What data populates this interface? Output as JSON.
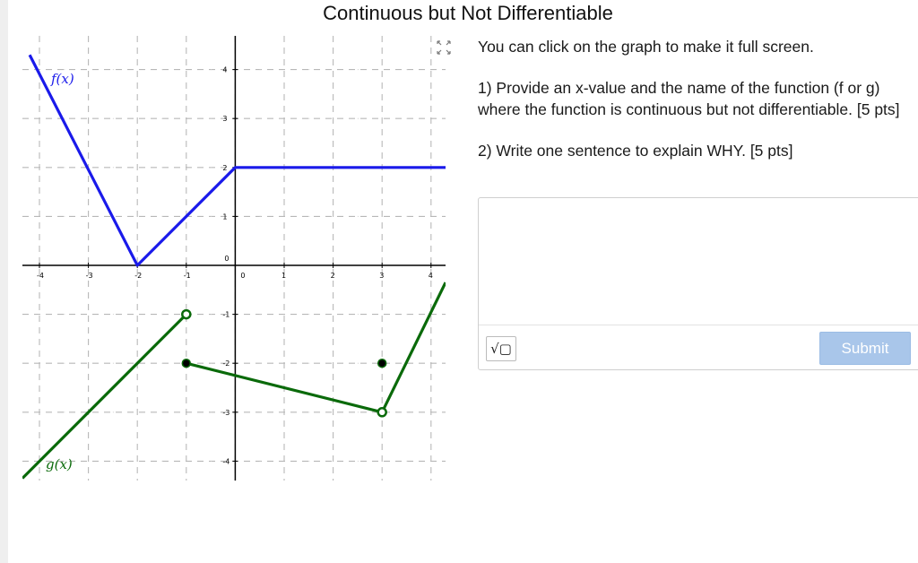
{
  "title": "Continuous but Not Differentiable",
  "instructions": {
    "intro": "You can click on the graph to make it full screen.",
    "q1": "1) Provide an x-value and the name of the function (f or g) where the function is continuous but not differentiable. [5 pts]",
    "q2": "2) Write one sentence to explain WHY. [5 pts]"
  },
  "graph": {
    "x_ticks": [
      "-4",
      "-3",
      "-2",
      "-1",
      "0",
      "1",
      "2",
      "3",
      "4"
    ],
    "y_ticks": [
      "4",
      "3",
      "2",
      "1",
      "0",
      "-1",
      "-2",
      "-3",
      "-4"
    ],
    "origin_label": "0",
    "f_label": "f(x)",
    "g_label": "g(x)",
    "colors": {
      "f": "#1a1aea",
      "g": "#0a6a0a",
      "grid": "#b8b8b8"
    }
  },
  "fullscreen_icon": "expand-arrows-icon",
  "toolbar": {
    "math_button_icon": "square-root-icon",
    "math_button_label": "√▢",
    "submit_label": "Submit"
  }
}
